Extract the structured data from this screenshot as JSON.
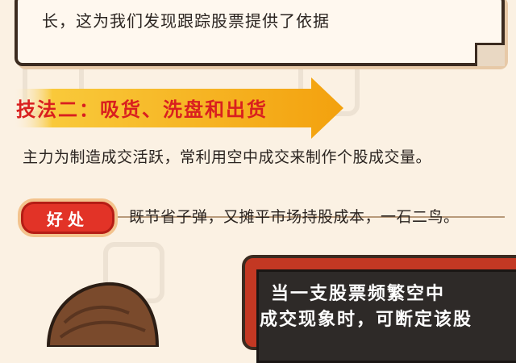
{
  "top_box": {
    "text": "长，这为我们发现跟踪股票提供了依据"
  },
  "section": {
    "title": "技法二：吸货、洗盘和出货"
  },
  "paragraph": {
    "text": "主力为制造成交活跃，常利用空中成交来制作个股成交量。"
  },
  "benefit": {
    "badge": "好处",
    "text": "既节省子弹，又摊平市场持股成本，一石二鸟。"
  },
  "board": {
    "line1": "当一支股票频繁空中",
    "line2": "成交现象时，可断定该股"
  },
  "colors": {
    "accent_red": "#d91f1f",
    "banner_yellow": "#f7b818",
    "badge_red": "#e23327",
    "background": "#fbf1e3"
  }
}
